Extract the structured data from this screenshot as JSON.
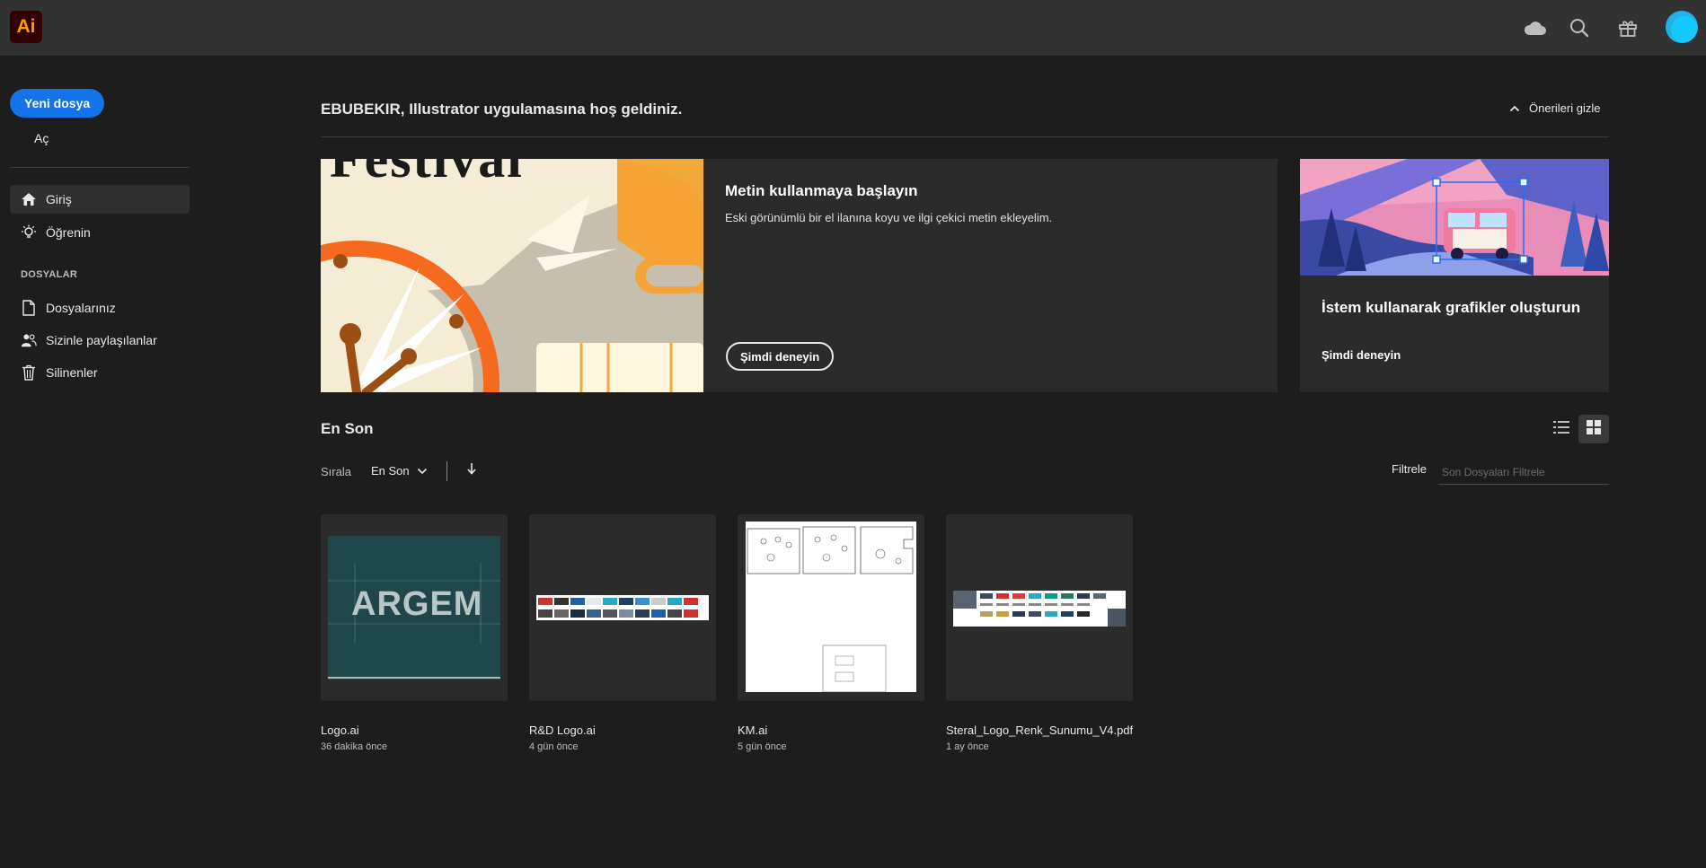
{
  "app": {
    "logo_text": "Ai",
    "accent": "#ff9a00"
  },
  "header": {
    "icons": [
      "cloud-icon",
      "search-icon",
      "gift-icon"
    ],
    "avatar_color": "#15c8ff"
  },
  "sidebar": {
    "new_file_label": "Yeni dosya",
    "open_label": "Aç",
    "nav": [
      {
        "label": "Giriş",
        "icon": "home-icon",
        "active": true
      },
      {
        "label": "Öğrenin",
        "icon": "lightbulb-icon",
        "active": false
      }
    ],
    "files_heading": "DOSYALAR",
    "files_nav": [
      {
        "label": "Dosyalarınız",
        "icon": "file-icon"
      },
      {
        "label": "Sizinle paylaşılanlar",
        "icon": "people-icon"
      },
      {
        "label": "Silinenler",
        "icon": "trash-icon"
      }
    ]
  },
  "main": {
    "welcome": "EBUBEKIR, Illustrator uygulamasına hoş geldiniz.",
    "hide_suggestions": "Önerileri gizle",
    "card_text": {
      "image_text": "Festival",
      "title": "Metin kullanmaya başlayın",
      "description": "Eski görünümlü bir el ilanına koyu ve ilgi çekici metin ekleyelim.",
      "button": "Şimdi deneyin"
    },
    "card_prompt": {
      "title": "İstem kullanarak grafikler oluşturun",
      "link": "Şimdi deneyin"
    },
    "recent": {
      "title": "En Son",
      "sort_label": "Sırala",
      "sort_value": "En Son",
      "filter_label": "Filtrele",
      "filter_placeholder": "Son Dosyaları Filtrele",
      "thumb_text_argem": "ARGEM",
      "files": [
        {
          "name": "Logo.ai",
          "time": "36 dakika önce"
        },
        {
          "name": "R&D Logo.ai",
          "time": "4 gün önce"
        },
        {
          "name": "KM.ai",
          "time": "5 gün önce"
        },
        {
          "name": "Steral_Logo_Renk_Sunumu_V4.pdf",
          "time": "1 ay önce"
        }
      ]
    }
  }
}
